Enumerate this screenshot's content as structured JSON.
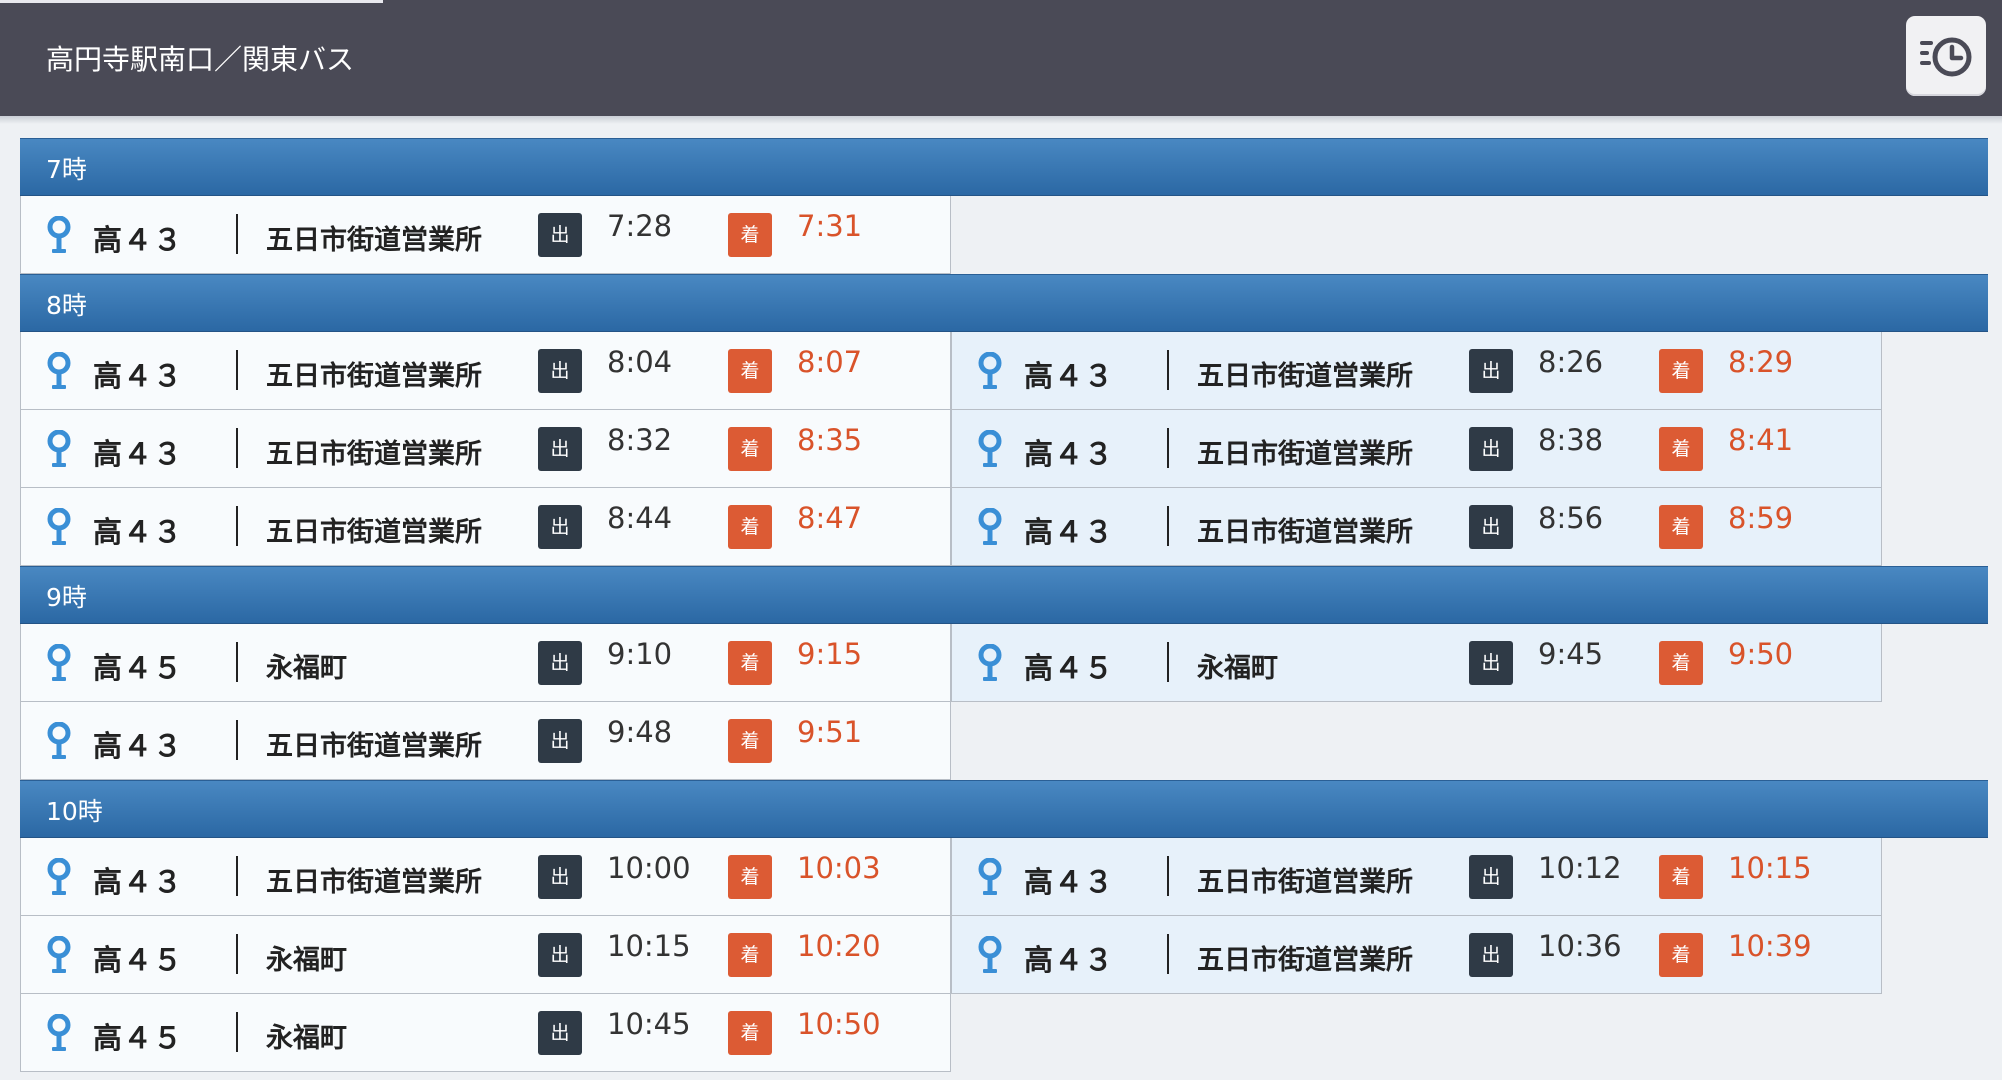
{
  "header": {
    "title": "高円寺駅南口／関東バス",
    "history_button_icon": "history-clock-icon"
  },
  "labels": {
    "departure": "出",
    "arrival": "着"
  },
  "colors": {
    "header_bg": "#4a4a56",
    "hour_header": "#3a78b4",
    "departure_badge": "#2f3a46",
    "arrival_badge": "#dc5b34",
    "arrival_text": "#d9532a",
    "pin": "#3a8fd6"
  },
  "hours": [
    {
      "label": "7時",
      "entries": [
        {
          "route": "高４３",
          "destination": "五日市街道営業所",
          "departure": "7:28",
          "arrival": "7:31"
        }
      ]
    },
    {
      "label": "8時",
      "entries": [
        {
          "route": "高４３",
          "destination": "五日市街道営業所",
          "departure": "8:04",
          "arrival": "8:07"
        },
        {
          "route": "高４３",
          "destination": "五日市街道営業所",
          "departure": "8:26",
          "arrival": "8:29"
        },
        {
          "route": "高４３",
          "destination": "五日市街道営業所",
          "departure": "8:32",
          "arrival": "8:35"
        },
        {
          "route": "高４３",
          "destination": "五日市街道営業所",
          "departure": "8:38",
          "arrival": "8:41"
        },
        {
          "route": "高４３",
          "destination": "五日市街道営業所",
          "departure": "8:44",
          "arrival": "8:47"
        },
        {
          "route": "高４３",
          "destination": "五日市街道営業所",
          "departure": "8:56",
          "arrival": "8:59"
        }
      ]
    },
    {
      "label": "9時",
      "entries": [
        {
          "route": "高４５",
          "destination": "永福町",
          "departure": "9:10",
          "arrival": "9:15"
        },
        {
          "route": "高４５",
          "destination": "永福町",
          "departure": "9:45",
          "arrival": "9:50"
        },
        {
          "route": "高４３",
          "destination": "五日市街道営業所",
          "departure": "9:48",
          "arrival": "9:51"
        }
      ]
    },
    {
      "label": "10時",
      "entries": [
        {
          "route": "高４３",
          "destination": "五日市街道営業所",
          "departure": "10:00",
          "arrival": "10:03"
        },
        {
          "route": "高４３",
          "destination": "五日市街道営業所",
          "departure": "10:12",
          "arrival": "10:15"
        },
        {
          "route": "高４５",
          "destination": "永福町",
          "departure": "10:15",
          "arrival": "10:20"
        },
        {
          "route": "高４３",
          "destination": "五日市街道営業所",
          "departure": "10:36",
          "arrival": "10:39"
        },
        {
          "route": "高４５",
          "destination": "永福町",
          "departure": "10:45",
          "arrival": "10:50"
        }
      ]
    }
  ]
}
